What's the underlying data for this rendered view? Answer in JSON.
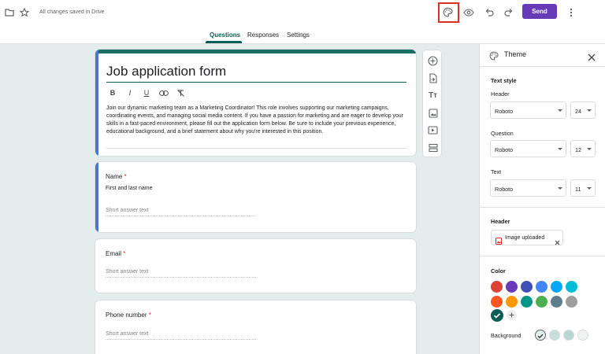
{
  "topbar": {
    "icons": [
      "folder-icon",
      "star-icon",
      "palette-icon",
      "preview-icon",
      "undo-icon",
      "redo-icon",
      "more-vert-icon"
    ],
    "saved_status": "All changes saved in Drive",
    "send_label": "Send",
    "accent_color": "#673ab7"
  },
  "tabs": [
    {
      "label": "Questions",
      "active": true
    },
    {
      "label": "Responses",
      "active": false
    },
    {
      "label": "Settings",
      "active": false
    }
  ],
  "form": {
    "title": "Job application form",
    "format_icons": [
      "bold-icon",
      "italic-icon",
      "underline-icon",
      "link-icon",
      "clear-format-icon"
    ],
    "format_glyphs": [
      "B",
      "I",
      "U",
      "⊂⊃",
      "T̸"
    ],
    "description": "Join our dynamic marketing team as a Marketing Coordinator! This role involves supporting our marketing campaigns, coordinating events, and managing social media content. If you have a passion for marketing and are eager to develop your skills in a fast-paced environment, please fill out the application form below. Be sure to include your previous experience, educational background, and a brief statement about why you're interested in this position.",
    "questions": [
      {
        "label": "Name",
        "required_mark": "*",
        "sub": "First and last name",
        "answer_placeholder": "Short answer text"
      },
      {
        "label": "Email",
        "required_mark": "*",
        "sub": "",
        "answer_placeholder": "Short answer text"
      },
      {
        "label": "Phone number",
        "required_mark": "*",
        "sub": "",
        "answer_placeholder": "Short answer text"
      }
    ]
  },
  "floating_toolbar": {
    "icons": [
      "add-question-icon",
      "import-questions-icon",
      "add-title-icon",
      "add-image-icon",
      "add-video-icon",
      "add-section-icon"
    ]
  },
  "theme_panel": {
    "title": "Theme",
    "text_style_heading": "Text style",
    "header_label": "Header",
    "header_font": "Roboto",
    "header_size": "24",
    "question_label": "Question",
    "question_font": "Roboto",
    "question_size": "12",
    "text_label": "Text",
    "text_font": "Roboto",
    "text_size": "11",
    "header_section_heading": "Header",
    "image_chip_label": "Image uploaded",
    "color_heading": "Color",
    "colors": [
      "#db4437",
      "#673ab7",
      "#3f51b5",
      "#4285f4",
      "#03a9f4",
      "#00bcd4",
      "#ff5722",
      "#ff9800",
      "#009688",
      "#4caf50",
      "#607d8b",
      "#9e9e9e"
    ],
    "selected_color": "#0b5e55",
    "background_label": "Background",
    "background_colors": [
      "#e3eeec",
      "#c7e0dc",
      "#b8d6d1",
      "#f1f3f3"
    ],
    "selected_background_index": 0
  }
}
